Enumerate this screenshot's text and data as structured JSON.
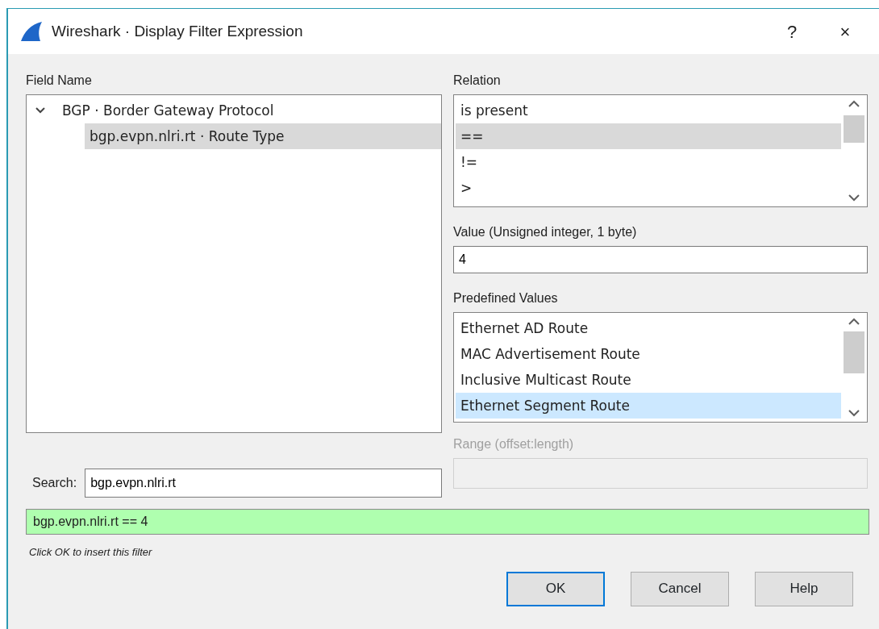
{
  "window": {
    "title": "Wireshark · Display Filter Expression",
    "help_glyph": "?",
    "close_glyph": "×"
  },
  "field_name": {
    "label": "Field Name",
    "tree": [
      {
        "label": "BGP · Border Gateway Protocol",
        "expanded": true,
        "selected": false,
        "children": [
          {
            "label": "bgp.evpn.nlri.rt · Route Type",
            "selected": true
          }
        ]
      }
    ]
  },
  "search": {
    "label": "Search:",
    "value": "bgp.evpn.nlri.rt"
  },
  "relation": {
    "label": "Relation",
    "items": [
      {
        "label": "is present",
        "selected": false
      },
      {
        "label": "==",
        "selected": true
      },
      {
        "label": "!=",
        "selected": false
      },
      {
        "label": ">",
        "selected": false
      }
    ]
  },
  "value": {
    "label": "Value (Unsigned integer, 1 byte)",
    "value": "4"
  },
  "predefined_values": {
    "label": "Predefined Values",
    "items": [
      {
        "label": "Ethernet AD Route",
        "selected": false
      },
      {
        "label": "MAC Advertisement Route",
        "selected": false
      },
      {
        "label": "Inclusive Multicast Route",
        "selected": false
      },
      {
        "label": "Ethernet Segment Route",
        "selected": true
      }
    ]
  },
  "range": {
    "label": "Range (offset:length)",
    "disabled": true
  },
  "filter": {
    "value": "bgp.evpn.nlri.rt == 4",
    "valid": true
  },
  "hint": "Click OK to insert this filter",
  "buttons": [
    {
      "label": "OK",
      "default": true
    },
    {
      "label": "Cancel",
      "default": false
    },
    {
      "label": "Help",
      "default": false
    }
  ]
}
